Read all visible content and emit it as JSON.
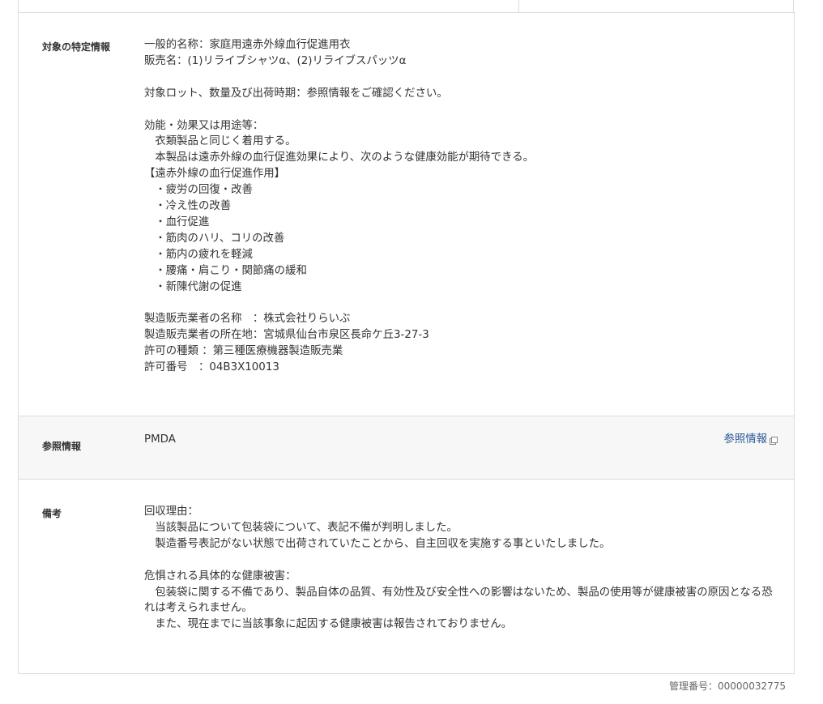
{
  "rows": [
    {
      "label": "対象の特定情報",
      "body": "一般的名称：家庭用遠赤外線血行促進用衣\n販売名：(1)リライブシャツα、(2)リライブスパッツα\n\n対象ロット、数量及び出荷時期：参照情報をご確認ください。\n\n効能・効果又は用途等：\n　衣類製品と同じく着用する。\n　本製品は遠赤外線の血行促進効果により、次のような健康効能が期待できる。\n【遠赤外線の血行促進作用】\n　・疲労の回復・改善\n　・冷え性の改善\n　・血行促進\n　・筋肉のハリ、コリの改善\n　・筋内の疲れを軽減\n　・腰痛・肩こり・関節痛の緩和\n　・新陳代謝の促進\n\n製造販売業者の名称　：株式会社りらいぶ\n製造販売業者の所在地：宮城県仙台市泉区長命ケ丘3-27-3\n許可の種類 ：第三種医療機器製造販売業\n許可番号　：04B3X10013"
    },
    {
      "label": "参照情報",
      "body": "PMDA",
      "link_label": "参照情報",
      "link_icon": "external-link-icon"
    },
    {
      "label": "備考",
      "body": "回収理由：\n　当該製品について包装袋について、表記不備が判明しました。\n　製造番号表記がない状態で出荷されていたことから、自主回収を実施する事といたしました。\n\n危惧される具体的な健康被害：\n　包装袋に関する不備であり、製品自体の品質、有効性及び安全性への影響はないため、製品の使用等が健康被害の原因となる恐れは考えられません。\n　また、現在までに当該事象に起因する健康被害は報告されておりません。"
    }
  ],
  "management_number": "管理番号：00000032775",
  "colors": {
    "border": "#dcdcdc",
    "alt_row_bg": "#f7f7f7",
    "link": "#2b5797",
    "text": "#333333"
  }
}
